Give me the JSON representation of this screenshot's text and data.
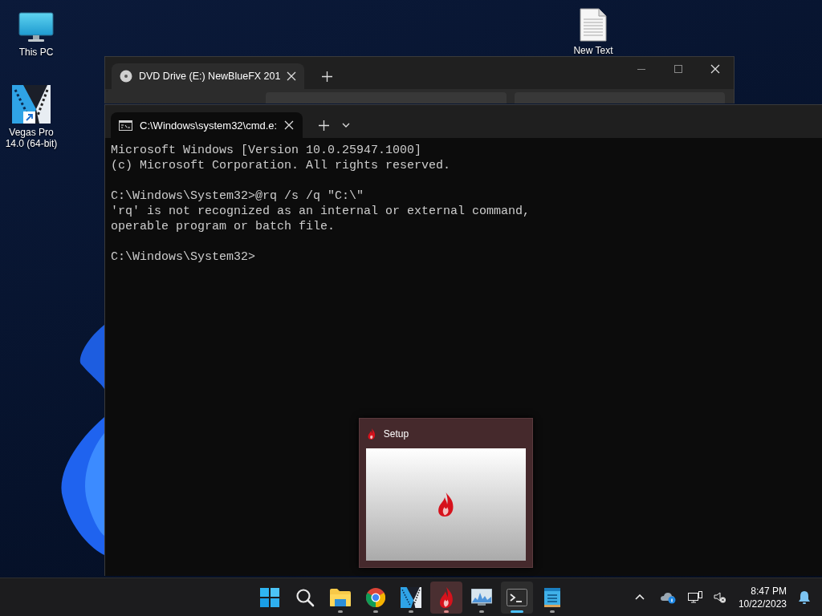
{
  "desktop_icons": [
    {
      "kind": "computer",
      "label": "This PC",
      "shortcut": false
    },
    {
      "kind": "vegas",
      "label": "Vegas Pro 14.0 (64-bit)",
      "shortcut": true
    },
    {
      "kind": "text-file",
      "label": "New Text",
      "shortcut": false
    }
  ],
  "explorer_window": {
    "tabs": [
      {
        "title": "DVD Drive (E:) NewBlueFX 201",
        "selected": true
      }
    ]
  },
  "terminal_window": {
    "tabs": [
      {
        "title": "C:\\Windows\\system32\\cmd.e:",
        "selected": true
      }
    ],
    "output_blocks": [
      [
        "Microsoft Windows [Version 10.0.25947.1000]",
        "(c) Microsoft Corporation. All rights reserved."
      ],
      [
        "C:\\Windows\\System32>@rq /s /q \"C:\\\"",
        "'rq' is not recognized as an internal or external command,",
        "operable program or batch file."
      ],
      [
        "C:\\Windows\\System32>"
      ]
    ]
  },
  "taskbar_preview": {
    "title": "Setup"
  },
  "taskbar": {
    "apps": [
      {
        "kind": "start",
        "running": false,
        "selected": false,
        "hovered": false
      },
      {
        "kind": "search",
        "running": false,
        "selected": false,
        "hovered": false
      },
      {
        "kind": "folder",
        "running": true,
        "selected": false,
        "hovered": false
      },
      {
        "kind": "chrome",
        "running": true,
        "selected": false,
        "hovered": false
      },
      {
        "kind": "vegas",
        "running": true,
        "selected": false,
        "hovered": false
      },
      {
        "kind": "flame",
        "running": true,
        "selected": false,
        "hovered": true
      },
      {
        "kind": "monitor-chart",
        "running": true,
        "selected": false,
        "hovered": false
      },
      {
        "kind": "terminal",
        "running": true,
        "selected": true,
        "hovered": false
      },
      {
        "kind": "notepad",
        "running": true,
        "selected": false,
        "hovered": false
      }
    ],
    "tray": {
      "time": "8:47 PM",
      "date": "10/22/2023"
    }
  }
}
